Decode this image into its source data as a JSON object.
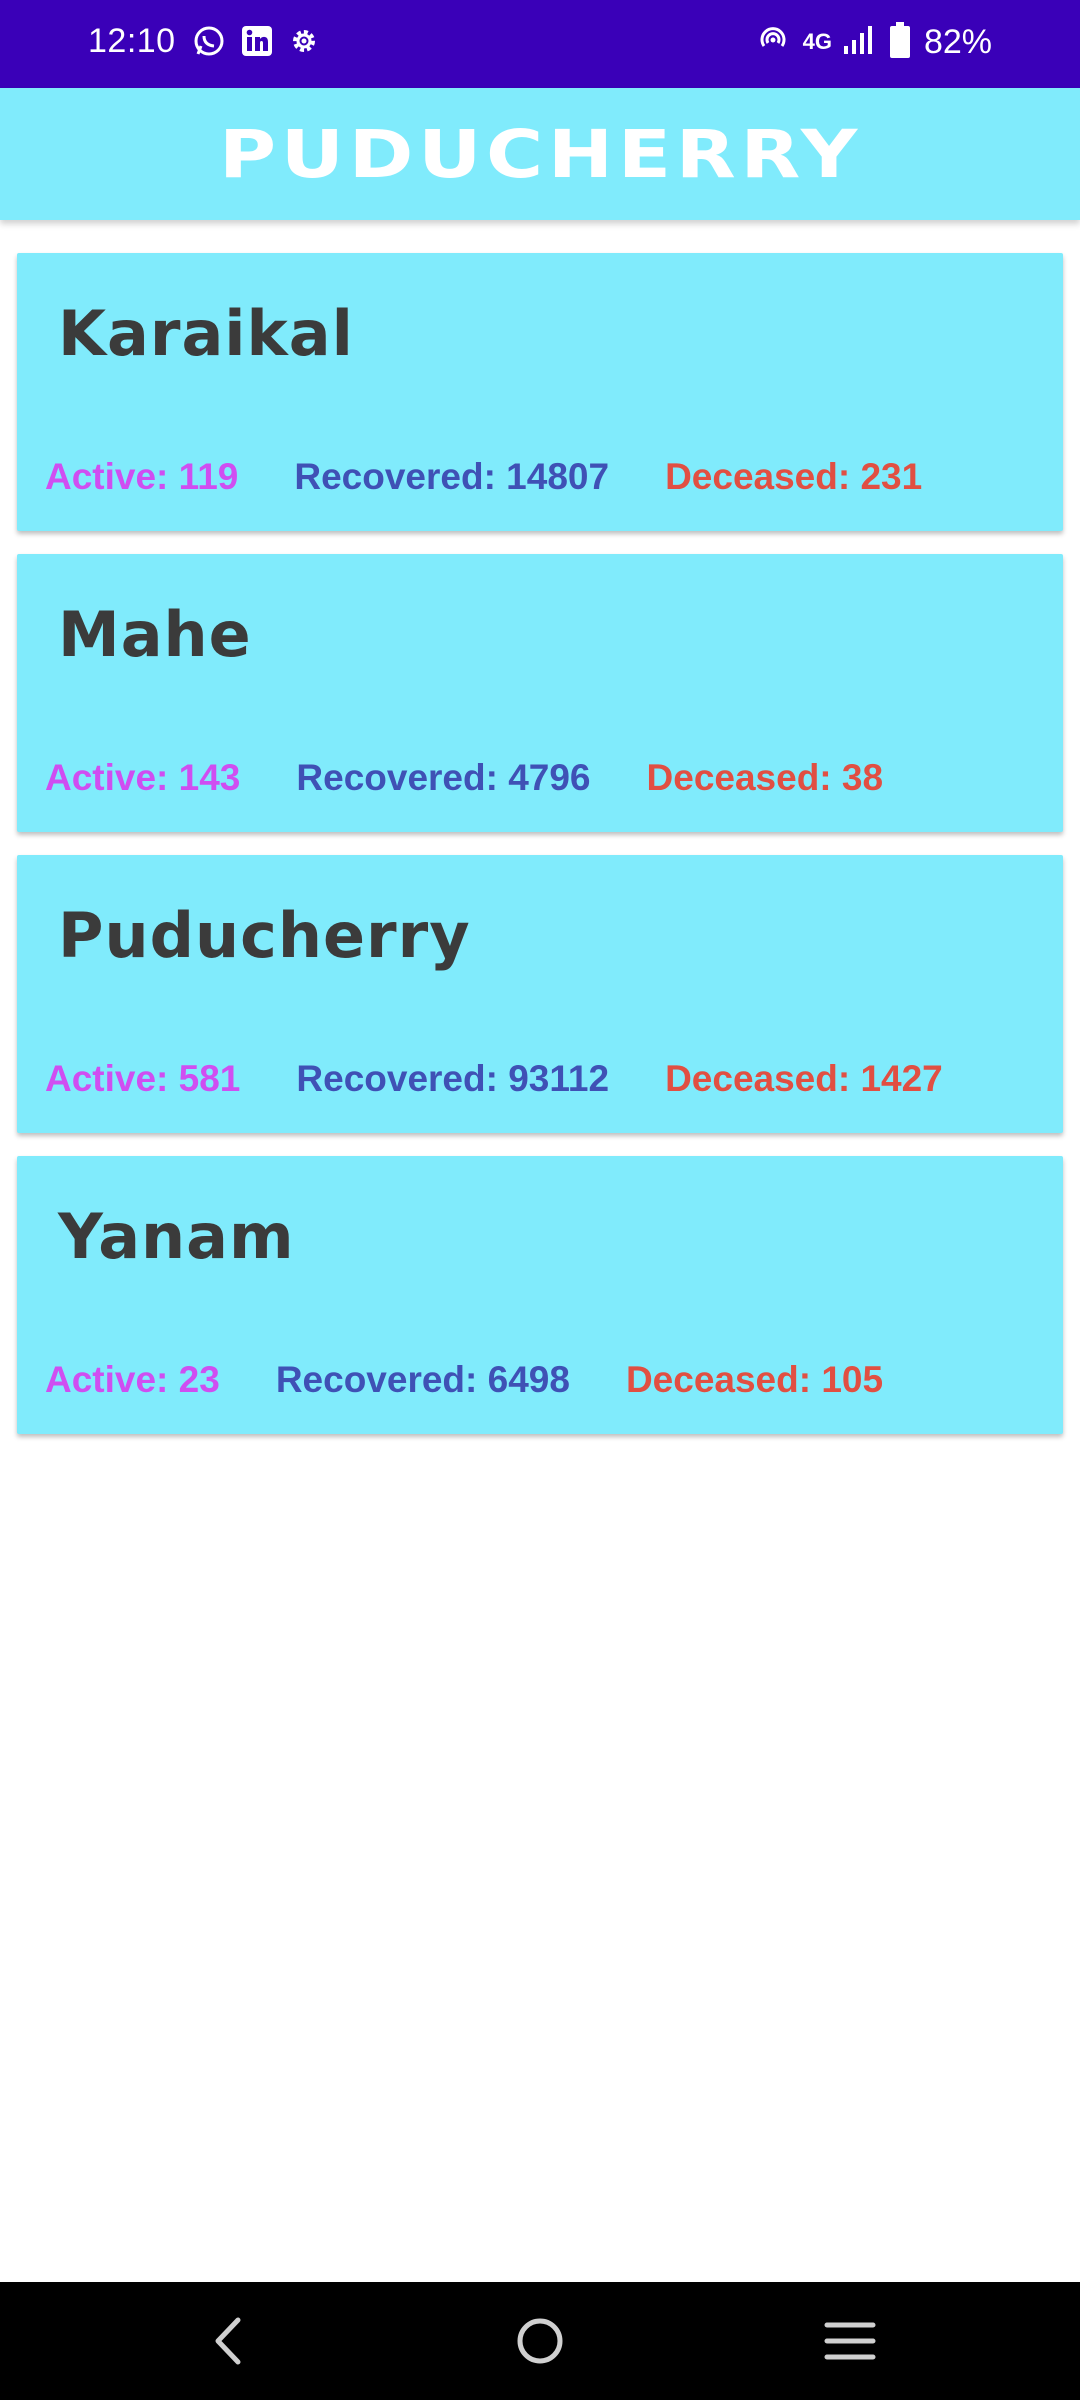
{
  "status_bar": {
    "time": "12:10",
    "network_label": "4G",
    "battery": "82%",
    "icons": [
      "whatsapp-icon",
      "linkedin-icon",
      "settings-icon",
      "hotspot-icon",
      "signal-icon",
      "battery-icon"
    ]
  },
  "header": {
    "title": "PUDUCHERRY"
  },
  "districts": [
    {
      "name": "Karaikal",
      "active": "Active: 119",
      "recovered": "Recovered: 14807",
      "deceased": "Deceased: 231"
    },
    {
      "name": "Mahe",
      "active": "Active: 143",
      "recovered": "Recovered: 4796",
      "deceased": "Deceased: 38"
    },
    {
      "name": "Puducherry",
      "active": "Active: 581",
      "recovered": "Recovered: 93112",
      "deceased": "Deceased: 1427"
    },
    {
      "name": "Yanam",
      "active": "Active: 23",
      "recovered": "Recovered: 6498",
      "deceased": "Deceased: 105"
    }
  ],
  "colors": {
    "status_bar": "#3a00b8",
    "header_bg": "#80ebfc",
    "card_bg": "#80ebfc",
    "active": "#cf4ef1",
    "recovered": "#3f51b5",
    "deceased": "#e14f42"
  },
  "nav": {
    "icons": [
      "back-icon",
      "home-icon",
      "recents-icon"
    ]
  }
}
